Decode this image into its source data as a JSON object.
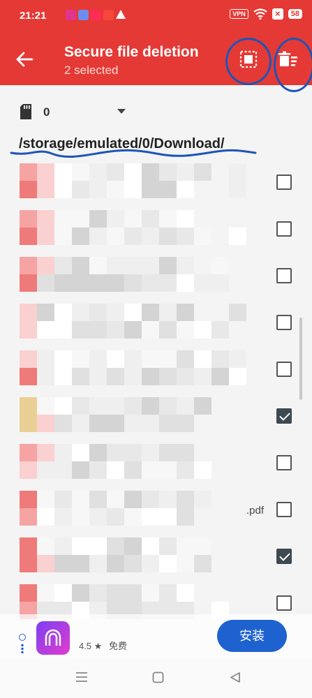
{
  "status_bar": {
    "time": "21:21",
    "vpn": "VPN",
    "battery": "58",
    "notification_icons": [
      {
        "name": "app-icon-pink",
        "color": "#e0358f"
      },
      {
        "name": "app-icon-colorful",
        "color": "#6d8cf0"
      },
      {
        "name": "music-icon",
        "color": "#ff2d55"
      },
      {
        "name": "video-play-icon",
        "color": "#f7463b"
      },
      {
        "name": "warning-icon",
        "color": "#ffffff"
      }
    ]
  },
  "app_bar": {
    "title": "Secure file deletion",
    "subtitle": "2 selected",
    "select_all_icon": "select-all-icon",
    "delete_icon": "delete-sweep-icon"
  },
  "storage": {
    "icon": "sd-card-icon",
    "selected": "0"
  },
  "current_path": "/storage/emulated/0/Download/",
  "files": [
    {
      "checked": false,
      "ext": ""
    },
    {
      "checked": false,
      "ext": ""
    },
    {
      "checked": false,
      "ext": ""
    },
    {
      "checked": false,
      "ext": ""
    },
    {
      "checked": false,
      "ext": ""
    },
    {
      "checked": true,
      "ext": ""
    },
    {
      "checked": false,
      "ext": ""
    },
    {
      "checked": false,
      "ext": ".pdf"
    },
    {
      "checked": true,
      "ext": ""
    },
    {
      "checked": false,
      "ext": ""
    }
  ],
  "ad": {
    "rating": "4.5 ★",
    "price": "免费",
    "install_label": "安装"
  },
  "nav_icons": [
    "menu-icon",
    "home-icon",
    "back-icon"
  ],
  "colors": {
    "accent": "#e53935",
    "annotation": "#1d55b8",
    "install": "#1e62d0",
    "checked": "#3e4a52"
  }
}
